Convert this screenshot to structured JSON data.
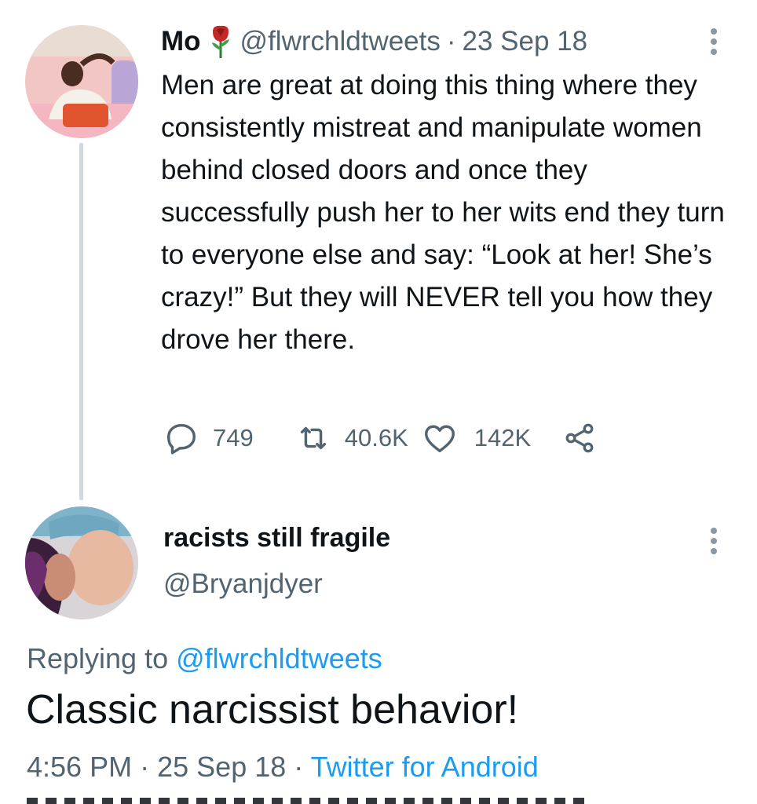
{
  "original_tweet": {
    "display_name": "Mo",
    "name_emoji_icon": "rose-icon",
    "handle": "@flwrchldtweets",
    "separator": "·",
    "date": "23 Sep 18",
    "text": "Men are great at doing this thing where they consistently mistreat and manipulate women behind closed doors and once they successfully push her to her wits end they turn to everyone else and say: “Look at her! She’s crazy!” But they will NEVER tell you how they drove her there.",
    "stats": {
      "replies": "749",
      "retweets": "40.6K",
      "likes": "142K"
    }
  },
  "reply_tweet": {
    "display_name": "racists still fragile",
    "handle": "@Bryanjdyer",
    "replying_to_prefix": "Replying to",
    "replying_to_handle": "@flwrchldtweets",
    "text": "Classic narcissist behavior!",
    "time": "4:56 PM",
    "separator1": "·",
    "date": "25 Sep 18",
    "separator2": "·",
    "source": "Twitter for Android"
  },
  "colors": {
    "text_primary": "#0f1419",
    "text_secondary": "#536471",
    "link": "#1d9bf0",
    "thread_line": "#cfd9de"
  }
}
